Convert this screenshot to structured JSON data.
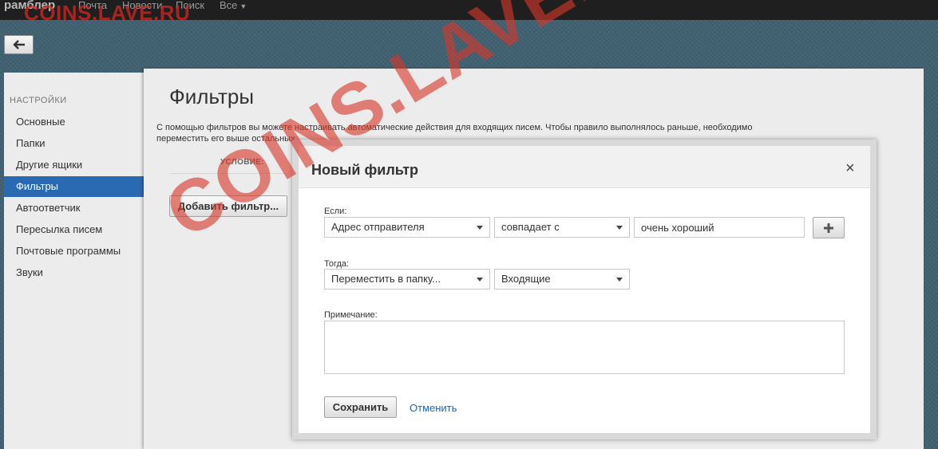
{
  "topbar": {
    "brand": "рамблер",
    "links": [
      "Почта",
      "Новости",
      "Поиск",
      "Все"
    ]
  },
  "sidebar": {
    "heading": "НАСТРОЙКИ",
    "items": [
      {
        "label": "Основные"
      },
      {
        "label": "Папки"
      },
      {
        "label": "Другие ящики"
      },
      {
        "label": "Фильтры",
        "active": true
      },
      {
        "label": "Автоответчик"
      },
      {
        "label": "Пересылка писем"
      },
      {
        "label": "Почтовые программы"
      },
      {
        "label": "Звуки"
      }
    ]
  },
  "main": {
    "title": "Фильтры",
    "description": "С помощью фильтров вы можете настраивать автоматические действия для входящих писем. Чтобы правило выполнялось раньше, необходимо переместить его выше остальных.",
    "condition_header": "УСЛОВИЕ:",
    "add_filter_label": "Добавить фильтр..."
  },
  "modal": {
    "title": "Новый фильтр",
    "close_glyph": "×",
    "if_label": "Если:",
    "condition_field": "Адрес отправителя",
    "condition_operator": "совпадает с",
    "condition_value": "очень хороший",
    "then_label": "Тогда:",
    "action": "Переместить в папку...",
    "target_folder": "Входящие",
    "note_label": "Примечание:",
    "note_value": "",
    "save_label": "Сохранить",
    "cancel_label": "Отменить"
  },
  "watermark": {
    "top": "COINS.LAVE.RU",
    "center": "COINS.LAVE.RU",
    "color": "#d8372a"
  },
  "colors": {
    "accent": "#2a6ab3",
    "link": "#1f64a8",
    "topbar": "#1f1f1f",
    "background": "#3f6071"
  }
}
